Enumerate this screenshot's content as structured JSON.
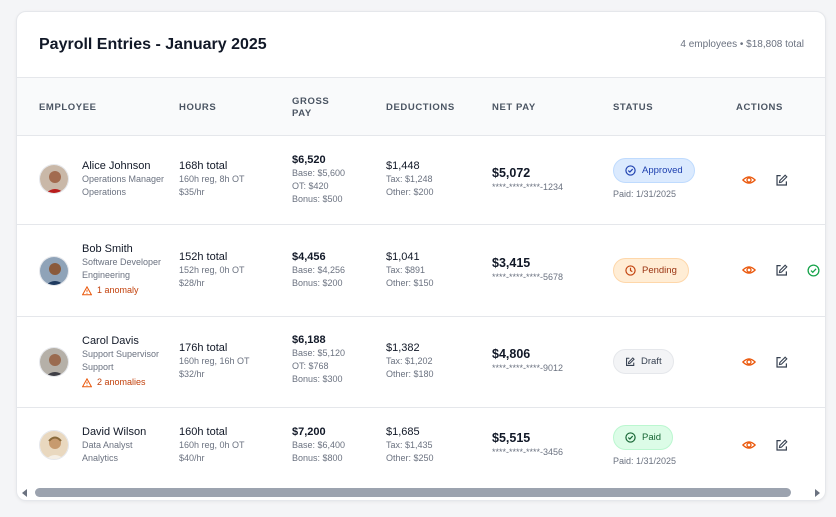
{
  "header": {
    "title": "Payroll Entries - January 2025",
    "summary": "4 employees • $18,808 total"
  },
  "columns": {
    "employee": "EMPLOYEE",
    "hours": "HOURS",
    "gross_line1": "GROSS",
    "gross_line2": "PAY",
    "deductions": "DEDUCTIONS",
    "net_pay": "NET PAY",
    "status": "STATUS",
    "actions": "ACTIONS"
  },
  "rows": [
    {
      "name": "Alice Johnson",
      "role": "Operations Manager",
      "department": "Operations",
      "anomaly": "",
      "hours_total": "168h total",
      "hours_breakdown": "160h reg, 8h OT",
      "rate": "$35/hr",
      "gross": "$6,520",
      "gross_base": "Base: $5,600",
      "gross_extra1": "OT: $420",
      "gross_extra2": "Bonus: $500",
      "deductions": "$1,448",
      "tax": "Tax: $1,248",
      "other": "Other: $200",
      "net": "$5,072",
      "account": "****-****-****-1234",
      "status": "Approved",
      "status_date": "Paid: 1/31/2025"
    },
    {
      "name": "Bob Smith",
      "role": "Software Developer",
      "department": "Engineering",
      "anomaly": "1 anomaly",
      "hours_total": "152h total",
      "hours_breakdown": "152h reg, 0h OT",
      "rate": "$28/hr",
      "gross": "$4,456",
      "gross_base": "Base: $4,256",
      "gross_extra1": "Bonus: $200",
      "gross_extra2": "",
      "deductions": "$1,041",
      "tax": "Tax: $891",
      "other": "Other: $150",
      "net": "$3,415",
      "account": "****-****-****-5678",
      "status": "Pending",
      "status_date": ""
    },
    {
      "name": "Carol Davis",
      "role": "Support Supervisor",
      "department": "Support",
      "anomaly": "2 anomalies",
      "hours_total": "176h total",
      "hours_breakdown": "160h reg, 16h OT",
      "rate": "$32/hr",
      "gross": "$6,188",
      "gross_base": "Base: $5,120",
      "gross_extra1": "OT: $768",
      "gross_extra2": "Bonus: $300",
      "deductions": "$1,382",
      "tax": "Tax: $1,202",
      "other": "Other: $180",
      "net": "$4,806",
      "account": "****-****-****-9012",
      "status": "Draft",
      "status_date": ""
    },
    {
      "name": "David Wilson",
      "role": "Data Analyst",
      "department": "Analytics",
      "anomaly": "",
      "hours_total": "160h total",
      "hours_breakdown": "160h reg, 0h OT",
      "rate": "$40/hr",
      "gross": "$7,200",
      "gross_base": "Base: $6,400",
      "gross_extra1": "Bonus: $800",
      "gross_extra2": "",
      "deductions": "$1,685",
      "tax": "Tax: $1,435",
      "other": "Other: $250",
      "net": "$5,515",
      "account": "****-****-****-3456",
      "status": "Paid",
      "status_date": "Paid: 1/31/2025"
    }
  ],
  "icons": {
    "view": "eye-icon",
    "edit": "edit-icon",
    "approve": "check-circle-icon",
    "anomaly": "warning-triangle-icon"
  },
  "colors": {
    "accent_orange": "#ea580c",
    "approved": "#1e40af",
    "pending": "#9a3412",
    "paid": "#166534",
    "approve_action": "#16a34a"
  }
}
